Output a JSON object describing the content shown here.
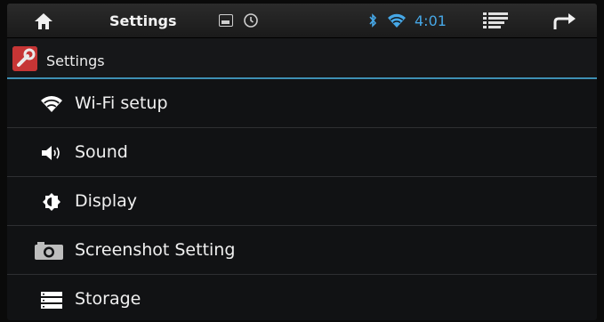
{
  "statusbar": {
    "title": "Settings",
    "time": "4:01",
    "icons": [
      "home-icon",
      "picture-icon",
      "sync-icon",
      "bluetooth-icon",
      "wifi-icon",
      "menu-icon",
      "back-icon"
    ],
    "time_color": "#46a7e6"
  },
  "header": {
    "title": "Settings",
    "accent": "#3d8fb3"
  },
  "items": [
    {
      "label": "Wi-Fi setup",
      "icon": "wifi-icon"
    },
    {
      "label": "Sound",
      "icon": "speaker-icon"
    },
    {
      "label": "Display",
      "icon": "brightness-icon"
    },
    {
      "label": "Screenshot Setting",
      "icon": "camera-icon"
    },
    {
      "label": "Storage",
      "icon": "storage-icon"
    }
  ]
}
